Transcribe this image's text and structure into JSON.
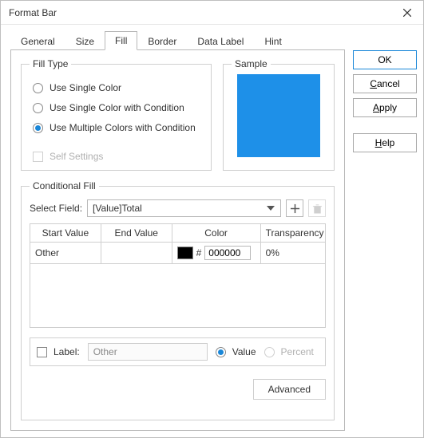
{
  "window": {
    "title": "Format Bar"
  },
  "buttons": {
    "ok": "OK",
    "cancel": "Cancel",
    "apply": "Apply",
    "help": "Help"
  },
  "tabs": {
    "general": "General",
    "size": "Size",
    "fill": "Fill",
    "border": "Border",
    "dataLabel": "Data Label",
    "hint": "Hint",
    "active": "fill"
  },
  "fill": {
    "fillTypeLegend": "Fill Type",
    "sampleLegend": "Sample",
    "sampleColor": "#1e90e8",
    "options": {
      "single": "Use Single Color",
      "singleCond": "Use Single Color with Condition",
      "multiCond": "Use Multiple Colors with Condition"
    },
    "selected": "multiCond",
    "selfSettings": "Self Settings"
  },
  "conditional": {
    "legend": "Conditional Fill",
    "selectFieldLabel": "Select Field:",
    "selectFieldValue": "[Value]Total",
    "columns": {
      "start": "Start Value",
      "end": "End Value",
      "color": "Color",
      "transparency": "Transparency"
    },
    "rows": [
      {
        "start": "Other",
        "end": "",
        "colorHex": "000000",
        "swatch": "#000000",
        "transparency": "0%"
      }
    ],
    "labelCheck": "Label:",
    "labelInput": "Other",
    "valueRadio": "Value",
    "percentRadio": "Percent",
    "advanced": "Advanced"
  }
}
